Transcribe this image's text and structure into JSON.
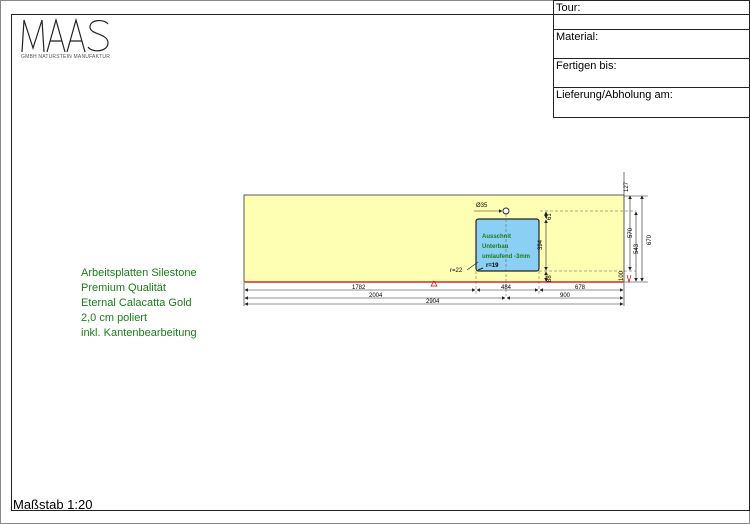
{
  "logo": {
    "name": "MAAS",
    "subtitle": "GMBH NATURSTEIN MANUFAKTUR"
  },
  "title_block": {
    "tour_label": "Tour:",
    "material_label": "Material:",
    "fertigen_label": "Fertigen bis:",
    "lieferung_label": "Lieferung/Abholung am:"
  },
  "specs": {
    "line1": "Arbeitsplatten Silestone",
    "line2": "Premium Qualität",
    "line3": "Eternal Calacatta Gold",
    "line4": "2,0 cm poliert",
    "line5": "inkl. Kantenbearbeitung"
  },
  "scale_label": "Maßstab 1:20",
  "drawing": {
    "cutout_line1": "Ausschnit",
    "cutout_line2": "Unterbau",
    "cutout_line3": "umlaufend -3mm",
    "corner_radius_label": "r=19",
    "radius_label": "r=22",
    "hole_label": "Ø35",
    "dims": {
      "d1782": "1782",
      "d484": "484",
      "d678": "678",
      "d2004": "2004",
      "d900": "900",
      "d2904": "2904",
      "d127": "127",
      "d61": "61",
      "d394": "394",
      "d88": "88",
      "d570": "570",
      "d543": "543",
      "d670": "670",
      "d100": "100"
    }
  },
  "colors": {
    "countertop_fill": "#ffffb3",
    "cutout_fill": "#8ccff5",
    "spec_text": "#1a7d1a",
    "front_edge": "#cc0000"
  }
}
